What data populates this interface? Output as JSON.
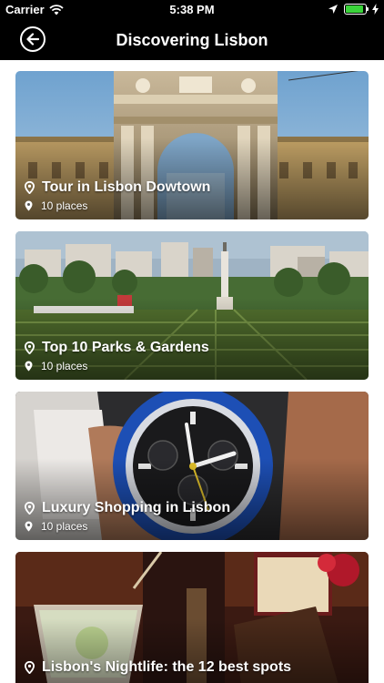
{
  "status_bar": {
    "carrier": "Carrier",
    "time": "5:38 PM",
    "battery_level": 0.9,
    "icons": [
      "wifi-icon",
      "location-arrow-icon",
      "battery-icon",
      "charging-bolt-icon"
    ]
  },
  "nav": {
    "title": "Discovering Lisbon",
    "back_icon": "back-arrow-circle-icon"
  },
  "colors": {
    "bar_background": "#000000",
    "text_on_image": "#ffffff",
    "battery": "#3ad33a"
  },
  "cards": [
    {
      "title": "Tour in Lisbon Dowtown",
      "count": "10 places",
      "icon": "map-pin-icon"
    },
    {
      "title": "Top 10 Parks & Gardens",
      "count": "10 places",
      "icon": "map-pin-icon"
    },
    {
      "title": "Luxury Shopping in Lisbon",
      "count": "10 places",
      "icon": "map-pin-icon"
    },
    {
      "title": "Lisbon's Nightlife: the 12 best spots",
      "count": "",
      "icon": "map-pin-icon"
    }
  ]
}
